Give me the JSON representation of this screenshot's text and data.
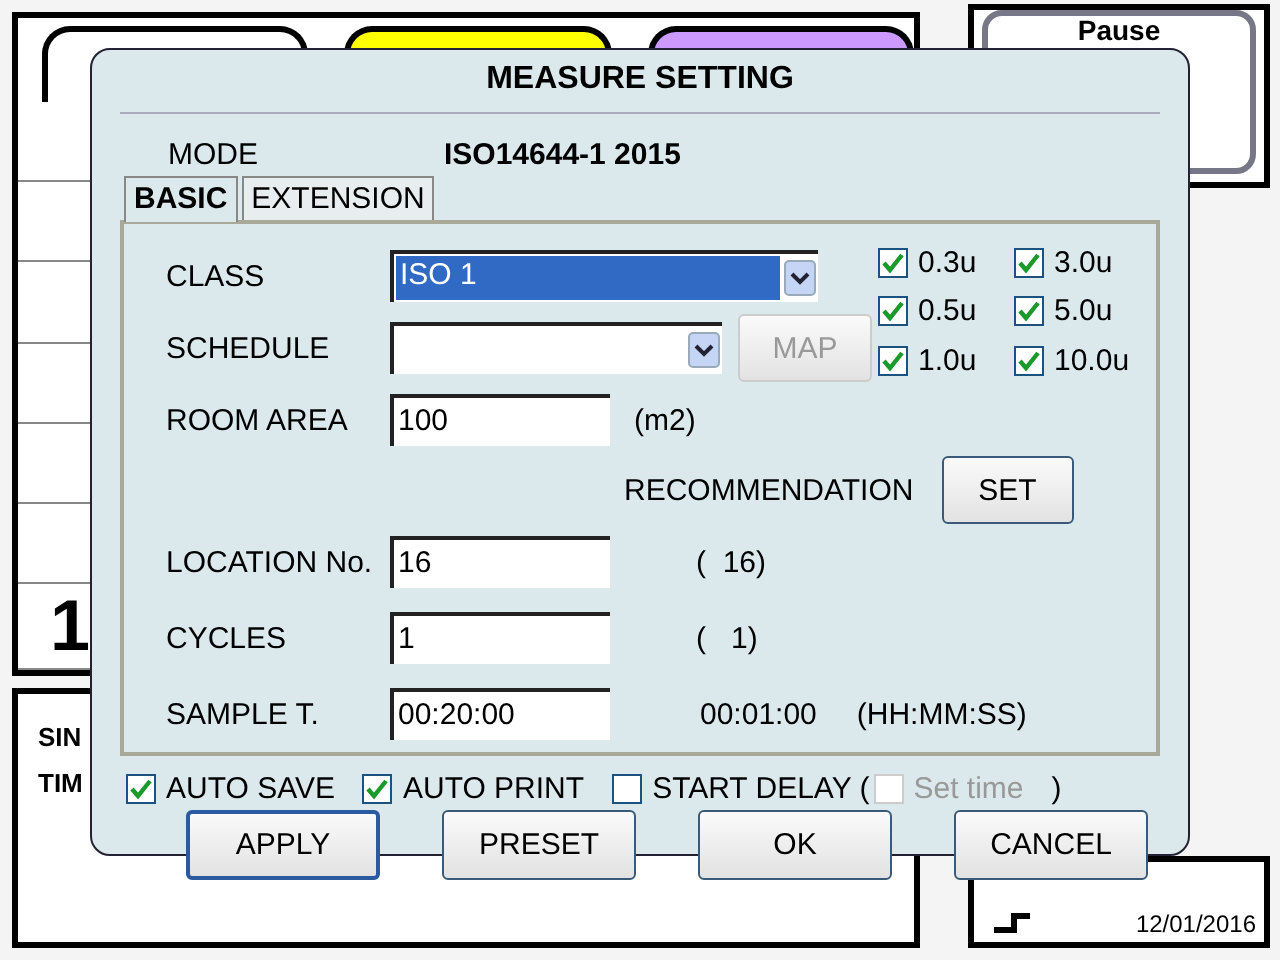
{
  "background": {
    "tabs": [
      {
        "color": "#ffffff"
      },
      {
        "color": "#ffff00"
      },
      {
        "color": "#cc99ff"
      }
    ],
    "pause_button": "Pause",
    "big_digit": "1",
    "info_labels": [
      "SIN",
      "TIM"
    ],
    "date": "12/01/2016"
  },
  "dialog": {
    "title": "MEASURE SETTING",
    "mode": {
      "label": "MODE",
      "value": "ISO14644-1 2015"
    },
    "tabs": [
      {
        "label": "BASIC",
        "selected": true
      },
      {
        "label": "EXTENSION",
        "selected": false
      }
    ],
    "class": {
      "label": "CLASS",
      "value": "ISO 1"
    },
    "schedule": {
      "label": "SCHEDULE"
    },
    "map_button": {
      "label": "MAP",
      "disabled": true
    },
    "sizes": [
      {
        "label": "0.3u",
        "checked": true
      },
      {
        "label": "3.0u",
        "checked": true
      },
      {
        "label": "0.5u",
        "checked": true
      },
      {
        "label": "5.0u",
        "checked": true
      },
      {
        "label": "1.0u",
        "checked": true
      },
      {
        "label": "10.0u",
        "checked": true
      }
    ],
    "room_area": {
      "label": "ROOM AREA",
      "value": "100",
      "unit": "(m2)"
    },
    "recommendation": {
      "label": "RECOMMENDATION",
      "button": "SET"
    },
    "location": {
      "label": "LOCATION No.",
      "value": "16",
      "recommended": "(  16)"
    },
    "cycles": {
      "label": "CYCLES",
      "value": "1",
      "recommended": "(   1)"
    },
    "sample_time": {
      "label": "SAMPLE T.",
      "value": "00:20:00",
      "recommended": "00:01:00",
      "unit": "(HH:MM:SS)"
    },
    "options": [
      {
        "label": "AUTO SAVE",
        "checked": true
      },
      {
        "label": "AUTO PRINT",
        "checked": true
      },
      {
        "label": "START DELAY (",
        "checked": false
      }
    ],
    "set_time": {
      "label": "Set time",
      "checked": false,
      "disabled": true
    },
    "set_time_close": ")",
    "buttons": [
      {
        "label": "APPLY",
        "default": true
      },
      {
        "label": "PRESET",
        "default": false
      },
      {
        "label": "OK",
        "default": false
      },
      {
        "label": "CANCEL",
        "default": false
      }
    ]
  }
}
